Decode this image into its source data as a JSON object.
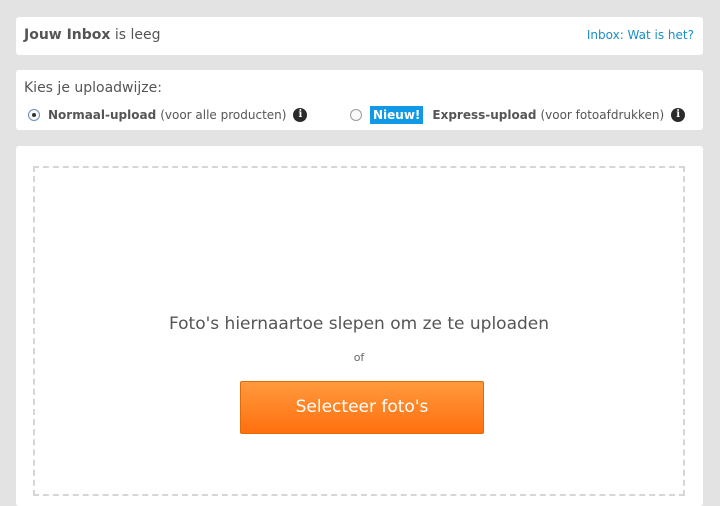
{
  "inbox": {
    "title_bold": "Jouw Inbox",
    "title_rest": " is leeg",
    "help_link": "Inbox: Wat is het?"
  },
  "upload_mode": {
    "title": "Kies je uploadwijze:",
    "normal": {
      "name": "Normaal-upload",
      "note": "(voor alle producten)",
      "selected": true
    },
    "express": {
      "badge": "Nieuw!",
      "name": "Express-upload",
      "note": "(voor fotoafdrukken)",
      "selected": false
    },
    "info_glyph": "i"
  },
  "dropzone": {
    "instruction": "Foto's hiernaartoe slepen om ze te uploaden",
    "or": "of",
    "button_label": "Selecteer foto's"
  },
  "colors": {
    "accent_link": "#1a8ec7",
    "badge": "#1199e6",
    "button_orange": "#ff7f1f"
  },
  "icons": [
    "info-icon",
    "radio-selected",
    "radio-unselected"
  ]
}
